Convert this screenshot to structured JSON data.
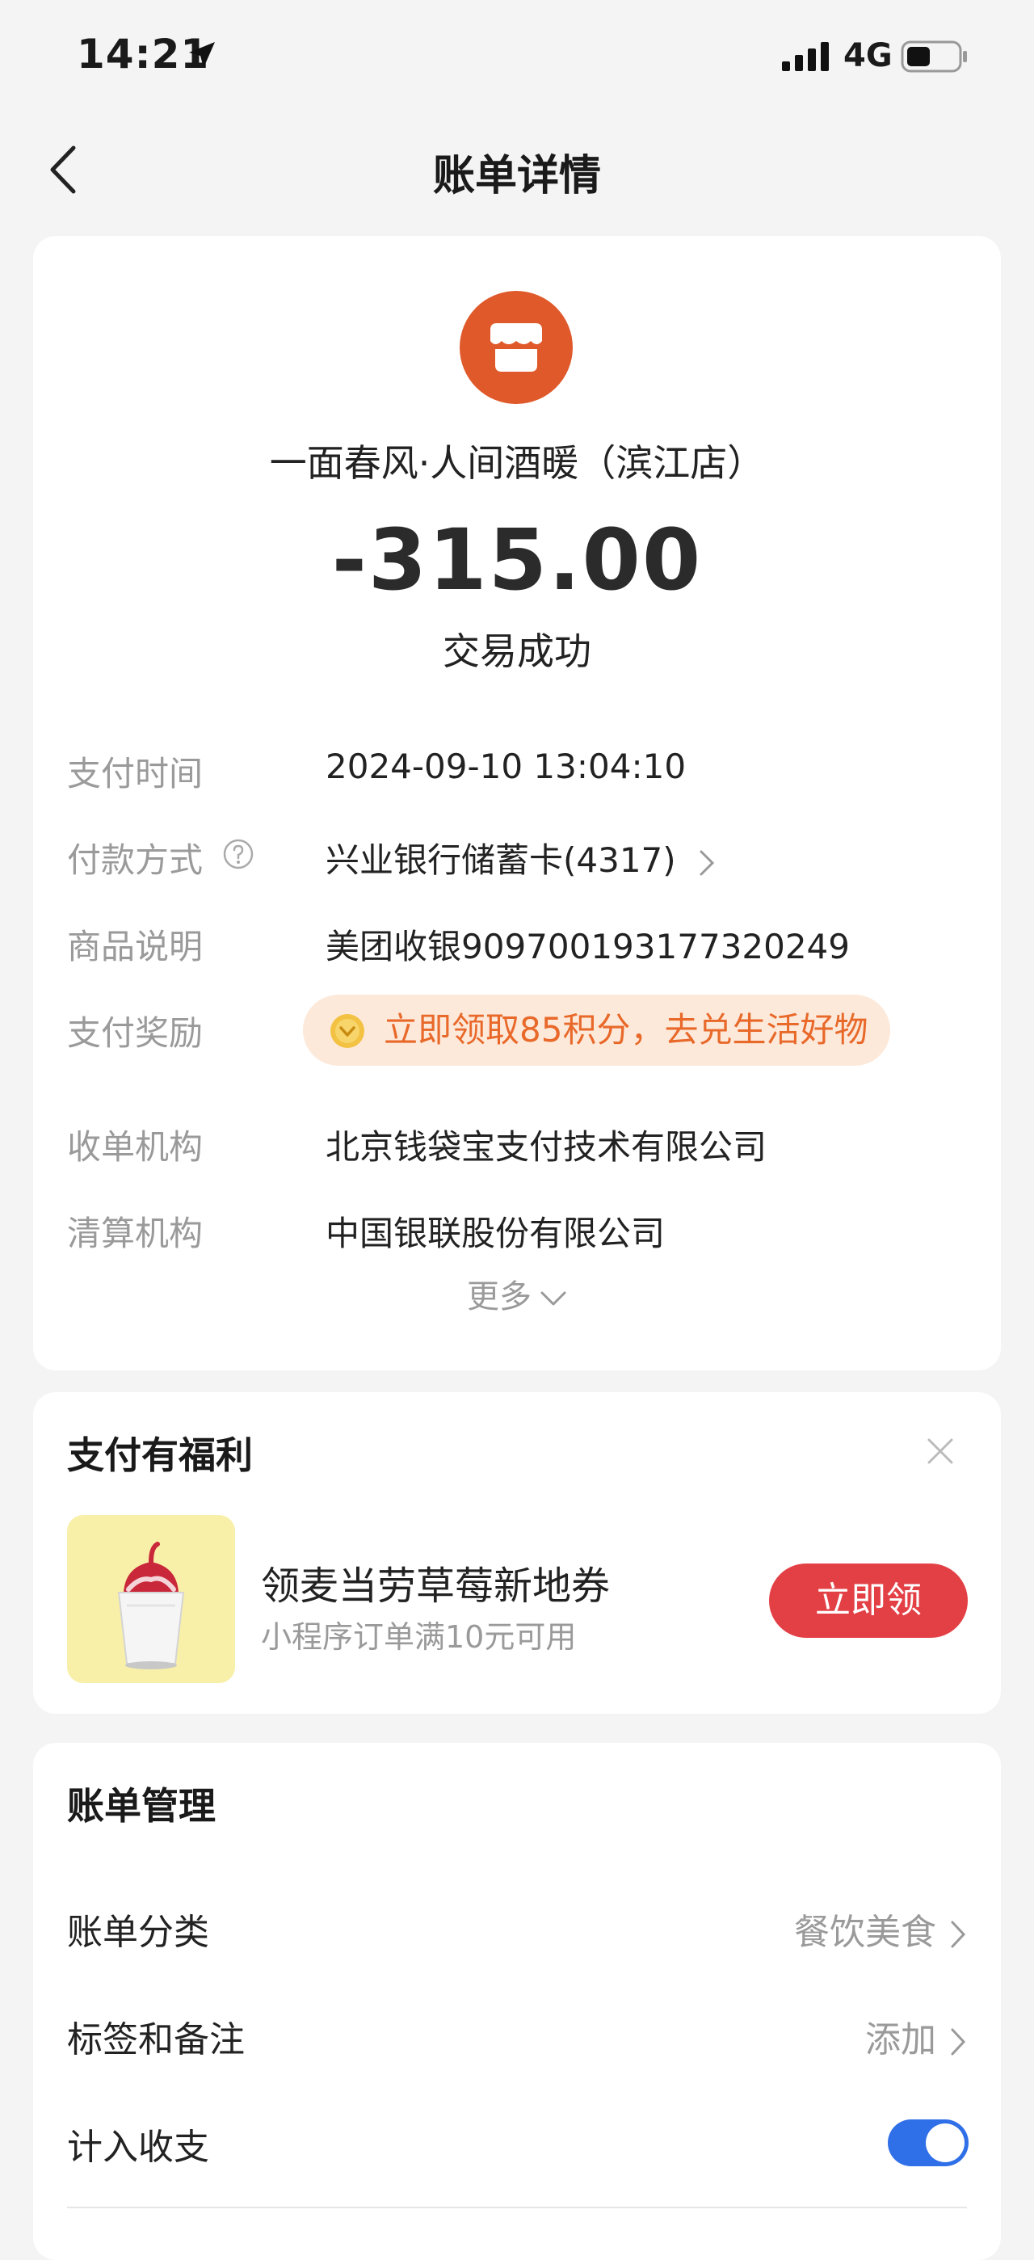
{
  "status_bar": {
    "time": "14:21",
    "network": "4G",
    "icons": [
      "location-arrow-icon",
      "signal-icon",
      "battery-icon"
    ]
  },
  "nav": {
    "title": "账单详情",
    "back_icon": "chevron-left-icon"
  },
  "summary": {
    "merchant_icon": "storefront-icon",
    "merchant_name": "一面春风·人间酒暖（滨江店）",
    "amount": "-315.00",
    "status": "交易成功",
    "details": [
      {
        "label": "支付时间",
        "value": "2024-09-10 13:04:10"
      },
      {
        "label": "付款方式",
        "value": "兴业银行储蓄卡(4317)"
      },
      {
        "label": "商品说明",
        "value": "美团收银909700193177320249"
      },
      {
        "label": "支付奖励",
        "value": "立即领取85积分，去兑生活好物"
      },
      {
        "label": "收单机构",
        "value": "北京钱袋宝支付技术有限公司"
      },
      {
        "label": "清算机构",
        "value": "中国银联股份有限公司"
      }
    ],
    "more_label": "更多"
  },
  "perk": {
    "title": "支付有福利",
    "item_name": "领麦当劳草莓新地券",
    "item_sub": "小程序订单满10元可用",
    "claim_label": "立即领"
  },
  "manage": {
    "title": "账单管理",
    "rows": [
      {
        "label": "账单分类",
        "value": "餐饮美食"
      },
      {
        "label": "标签和备注",
        "value": "添加"
      },
      {
        "label": "计入收支",
        "value": ""
      }
    ],
    "include_toggle_on": true
  },
  "colors": {
    "background": "#f4f4f4",
    "merchant_icon": "#e0592a",
    "reward_text": "#e8692a",
    "reward_bg": "#fde9da",
    "claim_button": "#e34046",
    "toggle_on": "#2f6fe8"
  }
}
